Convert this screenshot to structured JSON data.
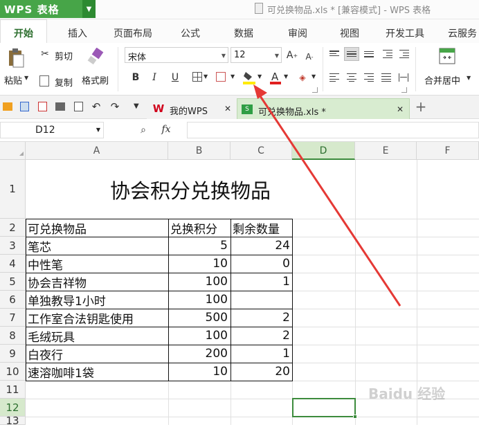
{
  "app": {
    "logo_text": "WPS 表格",
    "window_title": "可兑换物品.xls * [兼容模式] - WPS 表格"
  },
  "menu_tabs": [
    {
      "label": "开始",
      "active": true
    },
    {
      "label": "插入"
    },
    {
      "label": "页面布局"
    },
    {
      "label": "公式"
    },
    {
      "label": "数据"
    },
    {
      "label": "审阅"
    },
    {
      "label": "视图"
    },
    {
      "label": "开发工具"
    },
    {
      "label": "云服务"
    }
  ],
  "ribbon": {
    "paste": "粘贴",
    "cut": "剪切",
    "copy": "复制",
    "format_painter": "格式刷",
    "font_name": "宋体",
    "font_size": "12",
    "merge_center": "合并居中"
  },
  "doc_tabs": [
    {
      "label": "我的WPS"
    },
    {
      "label": "可兑换物品.xls *",
      "active": true
    }
  ],
  "formula_bar": {
    "cell_ref": "D12",
    "fx": "fx",
    "value": ""
  },
  "sheet": {
    "columns": [
      "A",
      "B",
      "C",
      "D",
      "E",
      "F"
    ],
    "rows": [
      "1",
      "2",
      "3",
      "4",
      "5",
      "6",
      "7",
      "8",
      "9",
      "10",
      "11",
      "12",
      "13"
    ],
    "title": "协会积分兑换物品",
    "header": [
      "可兑换物品",
      "兑换积分",
      "剩余数量"
    ],
    "data": [
      [
        "笔芯",
        "5",
        "24"
      ],
      [
        "中性笔",
        "10",
        "0"
      ],
      [
        "协会吉祥物",
        "100",
        "1"
      ],
      [
        "单独教导1小时",
        "100",
        ""
      ],
      [
        "工作室合法钥匙使用",
        "500",
        "2"
      ],
      [
        "毛绒玩具",
        "100",
        "2"
      ],
      [
        "白夜行",
        "200",
        "1"
      ],
      [
        "速溶咖啡1袋",
        "10",
        "20"
      ]
    ],
    "selected_cell": "D12"
  },
  "watermark": "Baidu 经验",
  "colors": {
    "accent": "#47a548",
    "arrow": "#e53935",
    "selection": "#3c8b3c"
  }
}
